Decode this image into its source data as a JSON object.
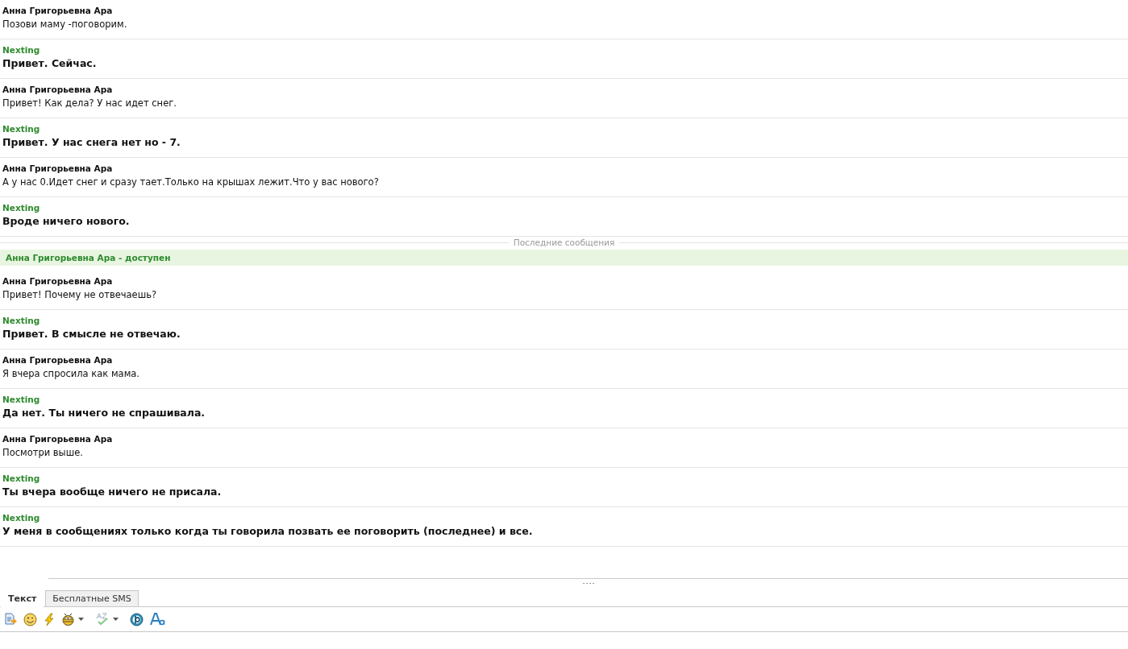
{
  "messages_before": [
    {
      "kind": "incoming",
      "sender": "Анна Григорьевна Ара",
      "text": "Позови маму -поговорим."
    },
    {
      "kind": "outgoing",
      "sender": "Nexting",
      "text": "Привет. Сейчас."
    },
    {
      "kind": "incoming",
      "sender": "Анна Григорьевна Ара",
      "text": "Привет! Как дела? У нас идет снег."
    },
    {
      "kind": "outgoing",
      "sender": "Nexting",
      "text": "Привет. У нас снега нет но - 7."
    },
    {
      "kind": "incoming",
      "sender": "Анна Григорьевна Ара",
      "text": "А у нас 0.Идет снег и сразу тает.Только на крышах лежит.Что у вас нового?"
    },
    {
      "kind": "outgoing",
      "sender": "Nexting",
      "text": "Вроде ничего нового."
    }
  ],
  "separator": "Последние сообщения",
  "status": "Анна Григорьевна Ара - доступен",
  "messages_after": [
    {
      "kind": "incoming",
      "sender": "Анна Григорьевна Ара",
      "text": "Привет! Почему не отвечаешь?"
    },
    {
      "kind": "outgoing",
      "sender": "Nexting",
      "text": "Привет. В смысле не отвечаю."
    },
    {
      "kind": "incoming",
      "sender": "Анна Григорьевна Ара",
      "text": "Я вчера спросила как мама."
    },
    {
      "kind": "outgoing",
      "sender": "Nexting",
      "text": "Да нет. Ты ничего не спрашивала."
    },
    {
      "kind": "incoming",
      "sender": "Анна Григорьевна Ара",
      "text": "Посмотри выше."
    },
    {
      "kind": "outgoing",
      "sender": "Nexting",
      "text": "Ты вчера вообще ничего не присала."
    },
    {
      "kind": "outgoing",
      "sender": "Nexting",
      "text": "У меня в сообщениях только когда ты говорила позвать ее поговорить (последнее) и все."
    }
  ],
  "tabs": [
    {
      "label": "Текст",
      "selected": true
    },
    {
      "label": "Бесплатные SMS",
      "selected": false
    }
  ]
}
